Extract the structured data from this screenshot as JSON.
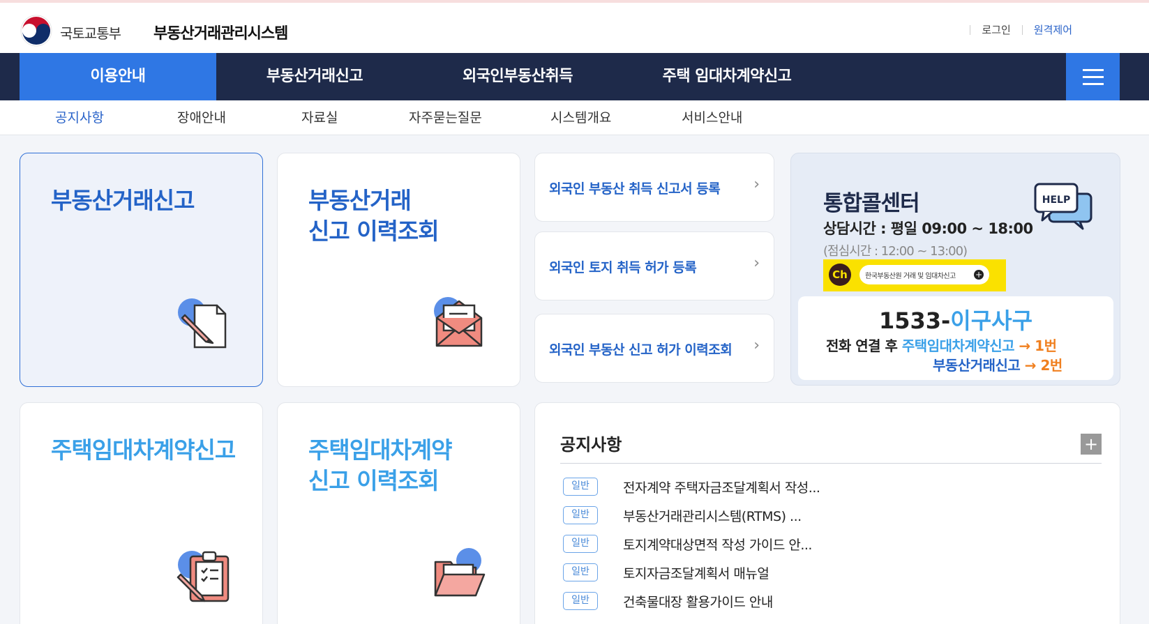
{
  "header": {
    "ministry": "국토교통부",
    "system_name": "부동산거래관리시스템",
    "login": "로그인",
    "remote": "원격제어"
  },
  "gnb": {
    "items": [
      "이용안내",
      "부동산거래신고",
      "외국인부동산취득",
      "주택 임대차계약신고"
    ],
    "active_index": 0
  },
  "subnav": {
    "items": [
      "공지사항",
      "장애안내",
      "자료실",
      "자주묻는질문",
      "시스템개요",
      "서비스안내"
    ],
    "active_index": 0
  },
  "cards": {
    "report": "부동산거래신고",
    "report_history": "부동산거래\n신고 이력조회",
    "lease": "주택임대차계약신고",
    "lease_history": "주택임대차계약\n신고 이력조회"
  },
  "foreign_links": [
    "외국인 부동산 취득 신고서 등록",
    "외국인 토지 취득 허가 등록",
    "외국인 부동산 신고 허가 이력조회"
  ],
  "call_center": {
    "title": "통합콜센터",
    "hours": "상담시간 : 평일 09:00 ~ 18:00",
    "lunch": "(점심시간 : 12:00 ~ 13:00)",
    "help_label": "HELP",
    "kakao_badge": "Ch",
    "kakao_text": "한국부동산원 거래 및 임대차신고",
    "phone_prefix": "1533-",
    "phone_suffix": "이구사구",
    "line1_a": "전화 연결 후 ",
    "line1_b": "주택임대차계약신고",
    "line1_c": " → 1번",
    "line2_b": "부동산거래신고",
    "line2_c": " → 2번"
  },
  "notice": {
    "title": "공지사항",
    "badge": "일반",
    "items": [
      "전자계약 주택자금조달계획서 작성...",
      "부동산거래관리시스템(RTMS) ...",
      "토지계약대상면적 작성 가이드 안...",
      "토지자금조달계획서 매뉴얼",
      "건축물대장 활용가이드 안내"
    ]
  },
  "colors": {
    "nav_bg": "#1e2a4a",
    "accent": "#2f77e4",
    "title_dark_blue": "#2463c7",
    "title_light_blue": "#3aa0e8",
    "orange": "#f08020"
  }
}
